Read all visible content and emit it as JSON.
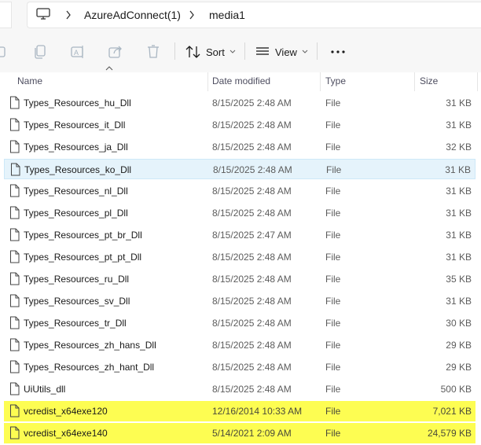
{
  "address_bar": {
    "crumbs": [
      "AzureAdConnect(1)",
      "media1"
    ]
  },
  "toolbar": {
    "sort_label": "Sort",
    "view_label": "View"
  },
  "columns": {
    "name": "Name",
    "date": "Date modified",
    "type": "Type",
    "size": "Size"
  },
  "files": [
    {
      "name": "Types_Resources_hu_Dll",
      "date": "8/15/2025 2:48 AM",
      "type": "File",
      "size": "31 KB"
    },
    {
      "name": "Types_Resources_it_Dll",
      "date": "8/15/2025 2:48 AM",
      "type": "File",
      "size": "31 KB"
    },
    {
      "name": "Types_Resources_ja_Dll",
      "date": "8/15/2025 2:48 AM",
      "type": "File",
      "size": "32 KB"
    },
    {
      "name": "Types_Resources_ko_Dll",
      "date": "8/15/2025 2:48 AM",
      "type": "File",
      "size": "31 KB"
    },
    {
      "name": "Types_Resources_nl_Dll",
      "date": "8/15/2025 2:48 AM",
      "type": "File",
      "size": "31 KB"
    },
    {
      "name": "Types_Resources_pl_Dll",
      "date": "8/15/2025 2:48 AM",
      "type": "File",
      "size": "31 KB"
    },
    {
      "name": "Types_Resources_pt_br_Dll",
      "date": "8/15/2025 2:47 AM",
      "type": "File",
      "size": "31 KB"
    },
    {
      "name": "Types_Resources_pt_pt_Dll",
      "date": "8/15/2025 2:48 AM",
      "type": "File",
      "size": "31 KB"
    },
    {
      "name": "Types_Resources_ru_Dll",
      "date": "8/15/2025 2:48 AM",
      "type": "File",
      "size": "35 KB"
    },
    {
      "name": "Types_Resources_sv_Dll",
      "date": "8/15/2025 2:48 AM",
      "type": "File",
      "size": "31 KB"
    },
    {
      "name": "Types_Resources_tr_Dll",
      "date": "8/15/2025 2:48 AM",
      "type": "File",
      "size": "30 KB"
    },
    {
      "name": "Types_Resources_zh_hans_Dll",
      "date": "8/15/2025 2:48 AM",
      "type": "File",
      "size": "29 KB"
    },
    {
      "name": "Types_Resources_zh_hant_Dll",
      "date": "8/15/2025 2:48 AM",
      "type": "File",
      "size": "29 KB"
    },
    {
      "name": "UiUtils_dll",
      "date": "8/15/2025 2:48 AM",
      "type": "File",
      "size": "500 KB"
    },
    {
      "name": "vcredist_x64exe120",
      "date": "12/16/2014 10:33 AM",
      "type": "File",
      "size": "7,021 KB"
    },
    {
      "name": "vcredist_x64exe140",
      "date": "5/14/2021 2:09 AM",
      "type": "File",
      "size": "24,579 KB"
    }
  ],
  "hover_row_index": 3,
  "highlighted_row_indices": [
    14,
    15
  ],
  "colors": {
    "highlight": "#fdfd52",
    "hover": "#e5f3fb"
  },
  "icons": {
    "address": "computer-icon",
    "file": "file-icon",
    "toolbar": [
      "copy-icon",
      "paste-icon",
      "rename-icon",
      "share-icon",
      "delete-icon",
      "sort-icon",
      "view-icon",
      "more-icon"
    ]
  }
}
